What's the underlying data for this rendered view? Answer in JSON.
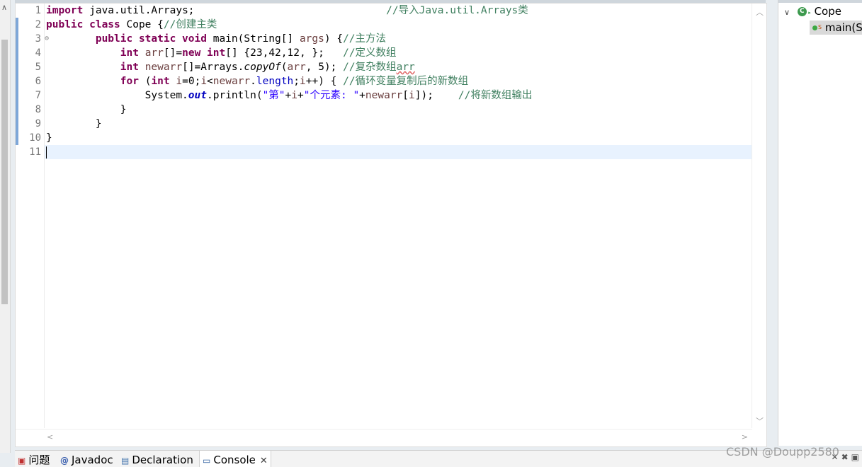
{
  "editor": {
    "line_numbers": [
      "1",
      "2",
      "3",
      "4",
      "5",
      "6",
      "7",
      "8",
      "9",
      "10",
      "11"
    ],
    "lines": [
      {
        "segments": [
          {
            "t": "kw",
            "v": "import"
          },
          {
            "t": "",
            "v": " java.util.Arrays;                               "
          },
          {
            "t": "cm",
            "v": "//导入Java.util.Arrays类"
          }
        ]
      },
      {
        "segments": [
          {
            "t": "kw",
            "v": "public class"
          },
          {
            "t": "",
            "v": " Cope {"
          },
          {
            "t": "cm",
            "v": "//创建主类"
          }
        ]
      },
      {
        "segments": [
          {
            "t": "",
            "v": "        "
          },
          {
            "t": "kw",
            "v": "public static void"
          },
          {
            "t": "",
            "v": " main(String[] "
          },
          {
            "t": "var",
            "v": "args"
          },
          {
            "t": "",
            "v": ") {"
          },
          {
            "t": "cm",
            "v": "//主方法"
          }
        ]
      },
      {
        "segments": [
          {
            "t": "",
            "v": "            "
          },
          {
            "t": "kw",
            "v": "int"
          },
          {
            "t": "",
            "v": " "
          },
          {
            "t": "var",
            "v": "arr"
          },
          {
            "t": "",
            "v": "[]="
          },
          {
            "t": "kw",
            "v": "new int"
          },
          {
            "t": "",
            "v": "[] {23,42,12, };   "
          },
          {
            "t": "cm",
            "v": "//定义数组"
          }
        ]
      },
      {
        "segments": [
          {
            "t": "",
            "v": "            "
          },
          {
            "t": "kw",
            "v": "int"
          },
          {
            "t": "",
            "v": " "
          },
          {
            "t": "var",
            "v": "newarr"
          },
          {
            "t": "",
            "v": "[]=Arrays."
          },
          {
            "t": "smeth",
            "v": "copyOf"
          },
          {
            "t": "",
            "v": "("
          },
          {
            "t": "var",
            "v": "arr"
          },
          {
            "t": "",
            "v": ", 5); "
          },
          {
            "t": "cm",
            "v": "//复杂数组"
          },
          {
            "t": "cm squig",
            "v": "arr"
          }
        ]
      },
      {
        "segments": [
          {
            "t": "",
            "v": "            "
          },
          {
            "t": "kw",
            "v": "for"
          },
          {
            "t": "",
            "v": " ("
          },
          {
            "t": "kw",
            "v": "int"
          },
          {
            "t": "",
            "v": " "
          },
          {
            "t": "var",
            "v": "i"
          },
          {
            "t": "",
            "v": "=0;"
          },
          {
            "t": "var",
            "v": "i"
          },
          {
            "t": "",
            "v": "<"
          },
          {
            "t": "var",
            "v": "newarr"
          },
          {
            "t": "",
            "v": "."
          },
          {
            "t": "fld",
            "v": "length"
          },
          {
            "t": "",
            "v": ";"
          },
          {
            "t": "var",
            "v": "i"
          },
          {
            "t": "",
            "v": "++) { "
          },
          {
            "t": "cm",
            "v": "//循环变量复制后的新数组"
          }
        ]
      },
      {
        "segments": [
          {
            "t": "",
            "v": "                System."
          },
          {
            "t": "sfld",
            "v": "out"
          },
          {
            "t": "",
            "v": ".println("
          },
          {
            "t": "st",
            "v": "\"第\""
          },
          {
            "t": "",
            "v": "+"
          },
          {
            "t": "var",
            "v": "i"
          },
          {
            "t": "",
            "v": "+"
          },
          {
            "t": "st",
            "v": "\"个元素: \""
          },
          {
            "t": "",
            "v": "+"
          },
          {
            "t": "var",
            "v": "newarr"
          },
          {
            "t": "",
            "v": "["
          },
          {
            "t": "var",
            "v": "i"
          },
          {
            "t": "",
            "v": "]);    "
          },
          {
            "t": "cm",
            "v": "//将新数组输出"
          }
        ]
      },
      {
        "segments": [
          {
            "t": "",
            "v": "            }"
          }
        ]
      },
      {
        "segments": [
          {
            "t": "",
            "v": "        }"
          }
        ]
      },
      {
        "segments": [
          {
            "t": "",
            "v": "}"
          }
        ]
      },
      {
        "segments": []
      }
    ]
  },
  "outline": {
    "class_label": "Cope",
    "method_label": "main(S",
    "static_marker": "S",
    "class_icon_letter": "C"
  },
  "tabs": [
    {
      "label": "问题",
      "icon": "problems-icon"
    },
    {
      "label": "Javadoc",
      "icon": "javadoc-icon"
    },
    {
      "label": "Declaration",
      "icon": "declaration-icon"
    },
    {
      "label": "Console",
      "icon": "console-icon",
      "active": true
    }
  ],
  "watermark": "CSDN @Doupp2580",
  "colors": {
    "keyword": "#7f0055",
    "comment": "#3f7f5f",
    "string": "#2a00ff",
    "field": "#0000c0",
    "current_line": "#e8f2fe"
  }
}
